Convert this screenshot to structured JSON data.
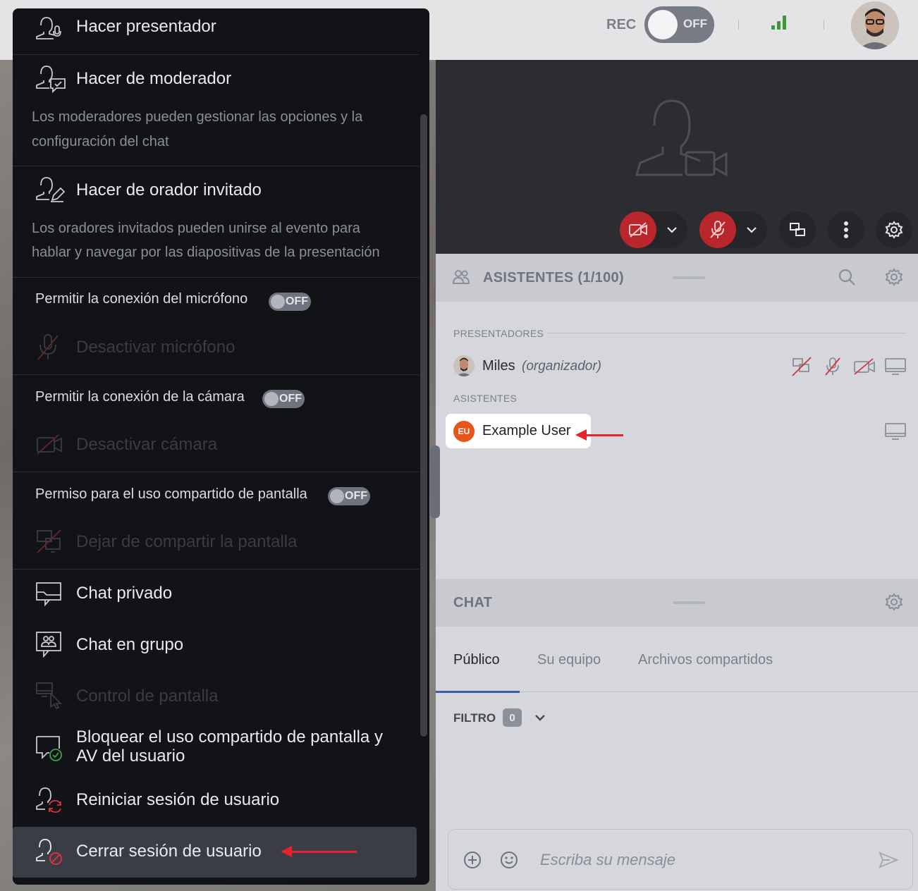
{
  "topbar": {
    "rec_label": "REC",
    "rec_toggle": "OFF"
  },
  "panels": {
    "attendees_title": "ASISTENTES (1/100)",
    "presenters_section": "PRESENTADORES",
    "attendees_section": "ASISTENTES",
    "presenter": {
      "name": "Miles",
      "role": "(organizador)"
    },
    "attendee": {
      "initials": "EU",
      "name": "Example User"
    },
    "chat_title": "CHAT"
  },
  "chat": {
    "tabs": [
      "Público",
      "Su equipo",
      "Archivos compartidos"
    ],
    "filter_label": "FILTRO",
    "filter_count": "0",
    "message_placeholder": "Escriba su mensaje"
  },
  "menu": {
    "make_presenter": "Hacer presentador",
    "make_moderator": "Hacer de moderador",
    "moderator_desc_1": "Los moderadores pueden gestionar las opciones y la",
    "moderator_desc_2": "configuración del chat",
    "make_guest_speaker": "Hacer de orador invitado",
    "guest_desc_1": "Los oradores invitados pueden unirse al evento para",
    "guest_desc_2": "hablar y navegar por las diapositivas de la presentación",
    "allow_mic": "Permitir la conexión del micrófono",
    "disable_mic": "Desactivar micrófono",
    "allow_camera": "Permitir la conexión de la cámara",
    "disable_camera": "Desactivar cámara",
    "allow_screenshare": "Permiso para el uso compartido de pantalla",
    "stop_screenshare": "Dejar de compartir la pantalla",
    "toggle_off": "OFF",
    "private_chat": "Chat privado",
    "group_chat": "Chat en grupo",
    "screen_control": "Control de pantalla",
    "block_line_1": "Bloquear el uso compartido de pantalla y",
    "block_line_2": "AV del usuario",
    "restart_session": "Reiniciar sesión de usuario",
    "logout_user": "Cerrar sesión de usuario"
  },
  "colors": {
    "accent_red": "#e8232e",
    "menu_bg": "#121317",
    "attendee_avatar": "#e8541a",
    "signal_green": "#3a9a3a"
  },
  "icons": [
    "person-mic-icon",
    "person-chat-icon",
    "person-edit-icon",
    "mic-off-icon",
    "camera-off-icon",
    "screen-off-icon",
    "chat-private-icon",
    "chat-group-icon",
    "screen-control-icon",
    "chat-check-icon",
    "person-refresh-icon",
    "person-block-icon"
  ]
}
